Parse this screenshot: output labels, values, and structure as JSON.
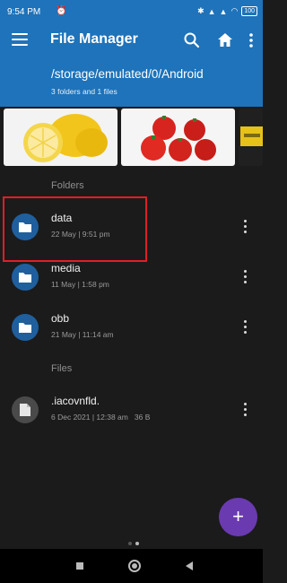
{
  "status_bar": {
    "time": "9:54 PM",
    "battery": "100"
  },
  "toolbar": {
    "title": "File Manager"
  },
  "location": {
    "path": "/storage/emulated/0/Android",
    "summary": "3 folders and 1 files"
  },
  "sections": {
    "folders": "Folders",
    "files": "Files"
  },
  "folders": [
    {
      "name": "data",
      "meta": "22 May | 9:51 pm"
    },
    {
      "name": "media",
      "meta": "11 May | 1:58 pm"
    },
    {
      "name": "obb",
      "meta": "21 May | 11:14 am"
    }
  ],
  "files": [
    {
      "name": ".iacovnfld.",
      "meta": "6 Dec 2021 | 12:38 am   36 B"
    }
  ],
  "fab": {
    "label": "+"
  },
  "colors": {
    "header": "#1e73ba",
    "folder_icon": "#1f5f9e",
    "fab": "#6a3ab1",
    "highlight": "#e01e25"
  }
}
